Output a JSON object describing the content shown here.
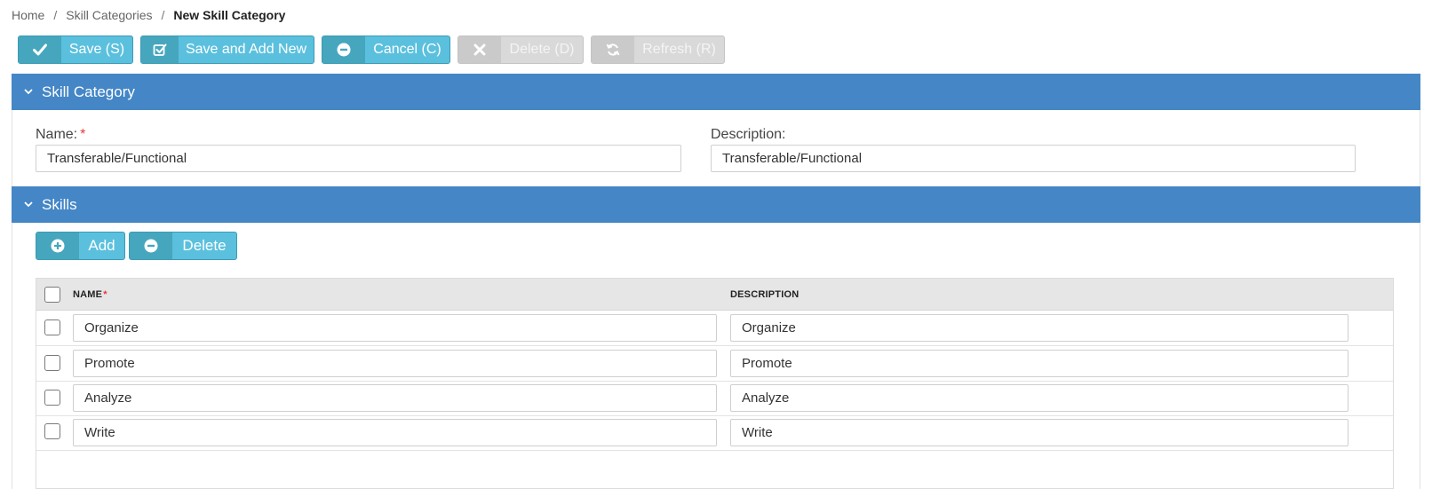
{
  "breadcrumb": {
    "home": "Home",
    "parent": "Skill Categories",
    "current": "New Skill Category",
    "separator": "/"
  },
  "toolbar": {
    "save": "Save (S)",
    "save_add_new": "Save and Add New",
    "cancel": "Cancel (C)",
    "delete": "Delete (D)",
    "refresh": "Refresh (R)"
  },
  "section_skill_category": {
    "title": "Skill Category",
    "name_label": "Name:",
    "required_mark": "*",
    "name_value": "Transferable/Functional",
    "description_label": "Description:",
    "description_value": "Transferable/Functional"
  },
  "section_skills": {
    "title": "Skills",
    "add_label": "Add",
    "delete_label": "Delete",
    "columns": {
      "name": "NAME",
      "required_mark": "*",
      "description": "DESCRIPTION"
    },
    "rows": [
      {
        "name": "Organize",
        "description": "Organize"
      },
      {
        "name": "Promote",
        "description": "Promote"
      },
      {
        "name": "Analyze",
        "description": "Analyze"
      },
      {
        "name": "Write",
        "description": "Write"
      }
    ]
  },
  "colors": {
    "section_header": "#4486c6",
    "button_primary": "#5bc0de",
    "button_icon_bg": "#46a6be",
    "button_disabled": "#d9d9d9",
    "required": "#e53935"
  },
  "icons": {
    "save": "check-icon",
    "save_add_new": "checkbox-check-icon",
    "cancel": "minus-circle-icon",
    "delete": "x-icon",
    "refresh": "refresh-icon",
    "collapse": "chevron-down-icon",
    "add": "plus-circle-icon",
    "remove": "minus-circle-icon"
  }
}
